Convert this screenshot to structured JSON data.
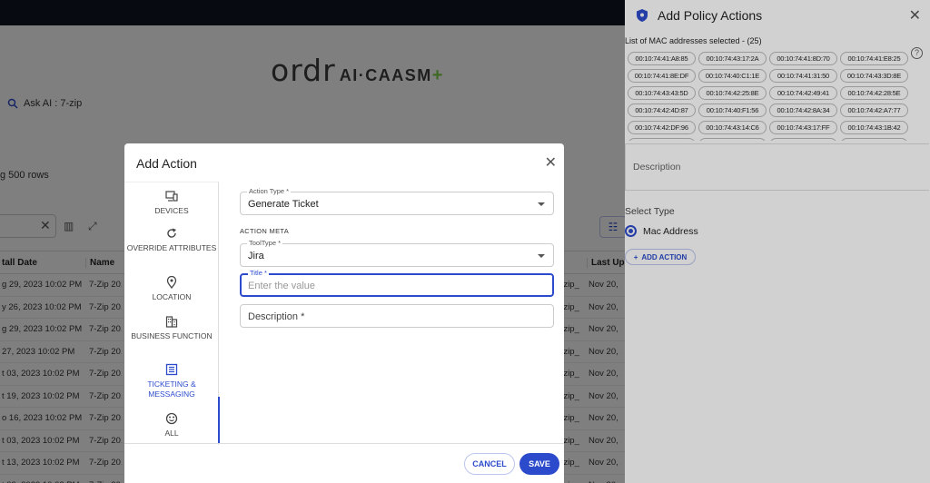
{
  "background": {
    "brand": {
      "main": "ordr",
      "sub": "AI·CAASM",
      "plus": "+"
    },
    "ask_ai": "Ask AI : 7-zip",
    "row_count": "g 500 rows",
    "table": {
      "columns": [
        "tall Date",
        "Name",
        "Last Up"
      ],
      "rows": [
        {
          "date": "g 29, 2023 10:02 PM",
          "name": "7-Zip 20.",
          "c3": "7-zip_",
          "c4": "Nov 20, 2"
        },
        {
          "date": "y 26, 2023 10:02 PM",
          "name": "7-Zip 20.",
          "c3": "7-zip_",
          "c4": "Nov 20, 2"
        },
        {
          "date": "g 29, 2023 10:02 PM",
          "name": "7-Zip 20.",
          "c3": "7-zip_",
          "c4": "Nov 20, 2"
        },
        {
          "date": "27, 2023 10:02 PM",
          "name": "7-Zip 20.",
          "c3": "7-zip_",
          "c4": "Nov 20, 2"
        },
        {
          "date": "t 03, 2023 10:02 PM",
          "name": "7-Zip 20.",
          "c3": "7-zip_",
          "c4": "Nov 20, 2"
        },
        {
          "date": "t 19, 2023 10:02 PM",
          "name": "7-Zip 20.",
          "c3": "7-zip_",
          "c4": "Nov 20, 2"
        },
        {
          "date": "o 16, 2023 10:02 PM",
          "name": "7-Zip 20.",
          "c3": "7-zip_",
          "c4": "Nov 20, 2"
        },
        {
          "date": "t 03, 2023 10:02 PM",
          "name": "7-Zip 20.",
          "c3": "7-zip_",
          "c4": "Nov 20, 2"
        },
        {
          "date": "t 13, 2023 10:02 PM",
          "name": "7-Zip 20.",
          "c3": "7-zip_",
          "c4": "Nov 20, 2"
        },
        {
          "date": "t 03, 2023 10:02 PM",
          "name": "7-Zip 20.",
          "c3": "7-zip_",
          "c4": "Nov 20, 2"
        }
      ]
    }
  },
  "panel": {
    "title": "Add Policy Actions",
    "mac_label": "List of MAC addresses selected - (25)",
    "macs": [
      "00:10:74:41:A8:85",
      "00:10:74:43:17:2A",
      "00:10:74:41:8D:70",
      "00:10:74:41:E8:25",
      "00:10:74:41:8E:DF",
      "00:10:74:40:C1:1E",
      "00:10:74:41:31:50",
      "00:10:74:43:3D:8E",
      "00:10:74:43:43:5D",
      "00:10:74:42:25:8E",
      "00:10:74:42:49:41",
      "00:10:74:42:28:5E",
      "00:10:74:42:4D:87",
      "00:10:74:40:F1:56",
      "00:10:74:42:8A:34",
      "00:10:74:42:A7:77",
      "00:10:74:42:DF:96",
      "00:10:74:43:14:C6",
      "00:10:74:43:17:FF",
      "00:10:74:43:1B:42",
      "00:10:74:42:C8:07",
      "00:10:74:42:C8:5F",
      "00:10:74:41:6A:A4",
      "00:10:74:43:34:18"
    ],
    "description_label": "Description",
    "select_type_label": "Select Type",
    "radio_label": "Mac Address",
    "add_action_label": "ADD ACTION"
  },
  "modal": {
    "title": "Add Action",
    "nav": [
      {
        "label": "DEVICES",
        "icon": "devices-icon"
      },
      {
        "label": "OVERRIDE ATTRIBUTES",
        "icon": "refresh-icon"
      },
      {
        "label": "LOCATION",
        "icon": "location-pin-icon"
      },
      {
        "label": "BUSINESS FUNCTION",
        "icon": "building-icon"
      },
      {
        "label": "TICKETING & MESSAGING",
        "icon": "ticket-list-icon"
      },
      {
        "label": "ALL",
        "icon": "all-icon"
      }
    ],
    "action_type": {
      "label": "Action Type *",
      "value": "Generate Ticket"
    },
    "action_meta_title": "ACTION META",
    "tool_type": {
      "label": "ToolType *",
      "value": "Jira"
    },
    "title_field": {
      "label": "Title *",
      "placeholder": "Enter the value"
    },
    "description_field": {
      "placeholder": "Description *"
    },
    "cancel_label": "CANCEL",
    "save_label": "SAVE"
  },
  "colors": {
    "accent": "#2c4bcc",
    "topbar": "#0f1420",
    "brand_plus": "#7fd34a"
  }
}
